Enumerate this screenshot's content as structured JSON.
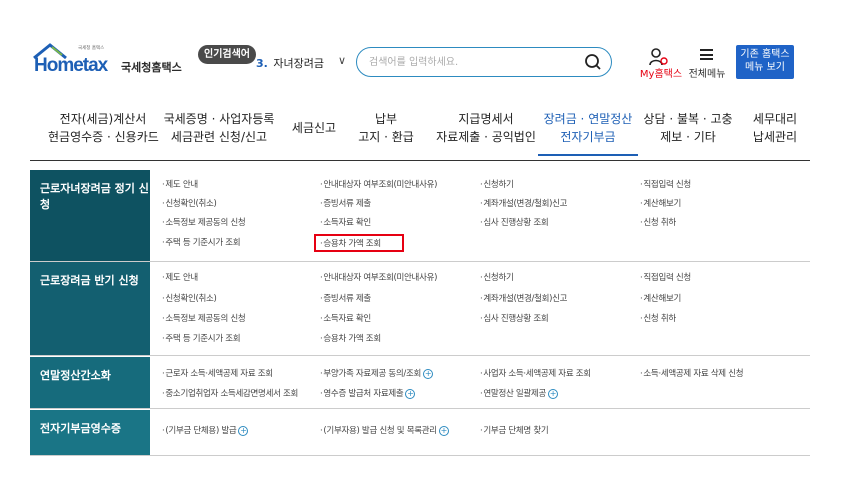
{
  "header": {
    "logo_small": "국세청 홈택스",
    "logo_text": "Hometax",
    "logo_kr": "국세청홈택스",
    "popular_badge": "인기검색어",
    "popular_num": "3.",
    "popular_keyword": "자녀장려금",
    "search_placeholder": "검색어를 입력하세요.",
    "my_hometax": "My홈택스",
    "all_menu": "전체메뉴",
    "old_home_line1": "기존 홈택스",
    "old_home_line2": "메뉴 보기"
  },
  "nav": [
    {
      "line1": "전자(세금)계산서",
      "line2": "현금영수증 · 신용카드"
    },
    {
      "line1": "국세증명 · 사업자등록",
      "line2": "세금관련 신청/신고"
    },
    {
      "line1": "세금신고",
      "line2": ""
    },
    {
      "line1": "납부",
      "line2": "고지 · 환급"
    },
    {
      "line1": "지급명세서",
      "line2": "자료제출 · 공익법인"
    },
    {
      "line1": "장려금 · 연말정산",
      "line2": "전자기부금"
    },
    {
      "line1": "상담 · 불복 · 고충",
      "line2": "제보 · 기타"
    },
    {
      "line1": "세무대리",
      "line2": "납세관리"
    }
  ],
  "sections": {
    "s1": {
      "title": "근로자녀장려금 정기 신청",
      "items": [
        "제도 안내",
        "신청확인(취소)",
        "소득정보 제공동의 신청",
        "주택 등 기준시가 조회",
        "안내대상자 여부조회(미안내사유)",
        "증빙서류 제출",
        "소득자료 확인",
        "승용차 가액 조회",
        "신청하기",
        "계좌개설(변경/철회)신고",
        "심사 진행상황 조회",
        "직접입력 신청",
        "계산해보기",
        "신청 취하"
      ]
    },
    "s2": {
      "title": "근로장려금 반기 신청",
      "items": [
        "제도 안내",
        "신청확인(취소)",
        "소득정보 제공동의 신청",
        "주택 등 기준시가 조회",
        "안내대상자 여부조회(미안내사유)",
        "증빙서류 제출",
        "소득자료 확인",
        "승용차 가액 조회",
        "신청하기",
        "계좌개설(변경/철회)신고",
        "심사 진행상황 조회",
        "직접입력 신청",
        "계산해보기",
        "신청 취하"
      ]
    },
    "s3": {
      "title": "연말정산간소화",
      "items": [
        "근로자 소득·세액공제 자료 조회",
        "중소기업취업자 소득세감면명세서 조회",
        "부양가족 자료제공 동의/조회",
        "영수증 발급처 자료제출",
        "사업자 소득·세액공제 자료 조회",
        "연말정산 일괄제공",
        "소득·세액공제 자료 삭제 신청"
      ]
    },
    "s4": {
      "title": "전자기부금영수증",
      "items": [
        "(기부금 단체용) 발급",
        "(기부자용) 발급 신청 및 목록관리",
        "기부금 단체명 찾기"
      ]
    }
  },
  "colors": {
    "accent": "#1d5fb5",
    "highlight": "#e60012",
    "section_bg": "#0f5465"
  }
}
